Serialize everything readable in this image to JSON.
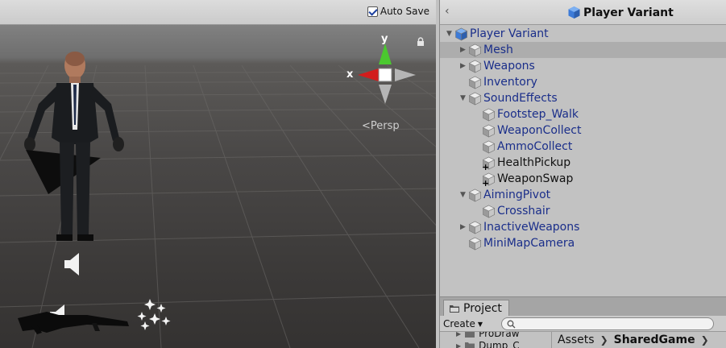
{
  "scene": {
    "autosave_label": "Auto Save",
    "autosave_checked": true,
    "view_mode_label": "Persp",
    "gizmo": {
      "x_label": "x",
      "y_label": "y"
    }
  },
  "hierarchy": {
    "title": "Player Variant",
    "items": [
      {
        "label": "Player Variant",
        "depth": 0,
        "arrow": "expanded",
        "style": "prefab",
        "icon": "prefab-cube-blue-icon"
      },
      {
        "label": "Mesh",
        "depth": 1,
        "arrow": "collapsed",
        "style": "prefab",
        "icon": "prefab-cube-icon",
        "selected": true
      },
      {
        "label": "Weapons",
        "depth": 1,
        "arrow": "collapsed",
        "style": "prefab",
        "icon": "prefab-cube-icon"
      },
      {
        "label": "Inventory",
        "depth": 1,
        "arrow": "none",
        "style": "prefab",
        "icon": "prefab-cube-icon"
      },
      {
        "label": "SoundEffects",
        "depth": 1,
        "arrow": "expanded",
        "style": "prefab",
        "icon": "prefab-cube-icon"
      },
      {
        "label": "Footstep_Walk",
        "depth": 2,
        "arrow": "none",
        "style": "prefab",
        "icon": "prefab-cube-icon"
      },
      {
        "label": "WeaponCollect",
        "depth": 2,
        "arrow": "none",
        "style": "prefab",
        "icon": "prefab-cube-icon"
      },
      {
        "label": "AmmoCollect",
        "depth": 2,
        "arrow": "none",
        "style": "prefab",
        "icon": "prefab-cube-icon"
      },
      {
        "label": "HealthPickup",
        "depth": 2,
        "arrow": "none",
        "style": "added",
        "icon": "added-object-icon"
      },
      {
        "label": "WeaponSwap",
        "depth": 2,
        "arrow": "none",
        "style": "added",
        "icon": "added-object-icon"
      },
      {
        "label": "AimingPivot",
        "depth": 1,
        "arrow": "expanded",
        "style": "prefab",
        "icon": "prefab-cube-icon"
      },
      {
        "label": "Crosshair",
        "depth": 2,
        "arrow": "none",
        "style": "prefab",
        "icon": "prefab-cube-icon"
      },
      {
        "label": "InactiveWeapons",
        "depth": 1,
        "arrow": "collapsed",
        "style": "prefab",
        "icon": "prefab-cube-icon"
      },
      {
        "label": "MiniMapCamera",
        "depth": 1,
        "arrow": "none",
        "style": "prefab",
        "icon": "prefab-cube-icon"
      }
    ]
  },
  "project": {
    "tab_label": "Project",
    "create_label": "Create",
    "search_placeholder": "",
    "folders": [
      {
        "label": "ProDraw"
      },
      {
        "label": "Dump_C"
      }
    ],
    "breadcrumb": [
      "Assets",
      "SharedGame"
    ]
  },
  "colors": {
    "prefab_text": "#1a2e8a",
    "selection": "#adadad",
    "gizmo_x": "#d21d1d",
    "gizmo_y": "#4bc82f",
    "panel_bg": "#c2c2c2"
  }
}
